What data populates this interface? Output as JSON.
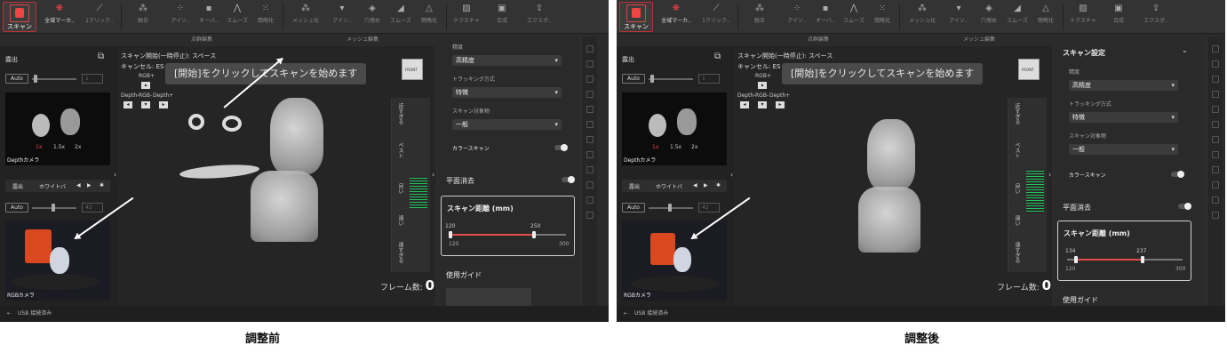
{
  "toolbar": {
    "scan": "スキャン",
    "global_marker": "全域マーカ..",
    "items": [
      "1クリック..",
      "融合",
      "アイソ..",
      "オーバ..",
      "スムーズ",
      "簡略化",
      "メッシュ化",
      "アイソ..",
      "穴埋め",
      "スムーズ",
      "簡略化",
      "テクスチャ",
      "合成",
      "エクスポ.."
    ],
    "group_pointcloud": "点群編集",
    "group_mesh": "メッシュ編集"
  },
  "left": {
    "exposure": "露出",
    "auto": "Auto",
    "depth_value": "1",
    "depth_camera": "Depthカメラ",
    "zoom": [
      "1x",
      "1.5x",
      "2x"
    ],
    "tab_exposure": "露出",
    "tab_white": "ホワイトバ",
    "rgb_value": "42",
    "rgb_camera": "RGBカメラ"
  },
  "viewport": {
    "hint1_before": "スキャン開始(一時停止): スペース",
    "hint1_after": "スキャン開始(一時停止): スペース",
    "hint2": "キャンセル: ES",
    "banner": "[開始]をクリックしてスキャンを始めます",
    "rgb_plus": "RGB+",
    "mini_labels": [
      "Depth-",
      "RGB-",
      "Depth+"
    ],
    "axis_front": "FRONT",
    "strip_labels": [
      "近すぎる",
      "ベスト",
      "良い",
      "遠い",
      "遠すぎる"
    ],
    "frame_label": "フレーム数:",
    "frame_count": "0"
  },
  "right": {
    "section": "スキャン設定",
    "precision_label": "精度",
    "precision_value": "高精度",
    "tracking_label": "トラッキング方式",
    "tracking_value": "特徴",
    "target_label": "スキャン対象物",
    "target_value": "一般",
    "color_scan": "カラースキャン",
    "plane_removal": "平面消去",
    "distance_title": "スキャン距離 (mm)",
    "before": {
      "low": "120",
      "high": "250",
      "min": "120",
      "max": "300",
      "low_val": 120,
      "high_val": 250
    },
    "after": {
      "low": "134",
      "high": "237",
      "min": "120",
      "max": "300",
      "low_val": 134,
      "high_val": 237
    },
    "guide": "使用ガイド"
  },
  "status": "USB 接続済み",
  "captions": {
    "before": "調整前",
    "after": "調整後"
  },
  "colors": {
    "accent": "#e64a4a",
    "bg": "#2b2b2b"
  }
}
